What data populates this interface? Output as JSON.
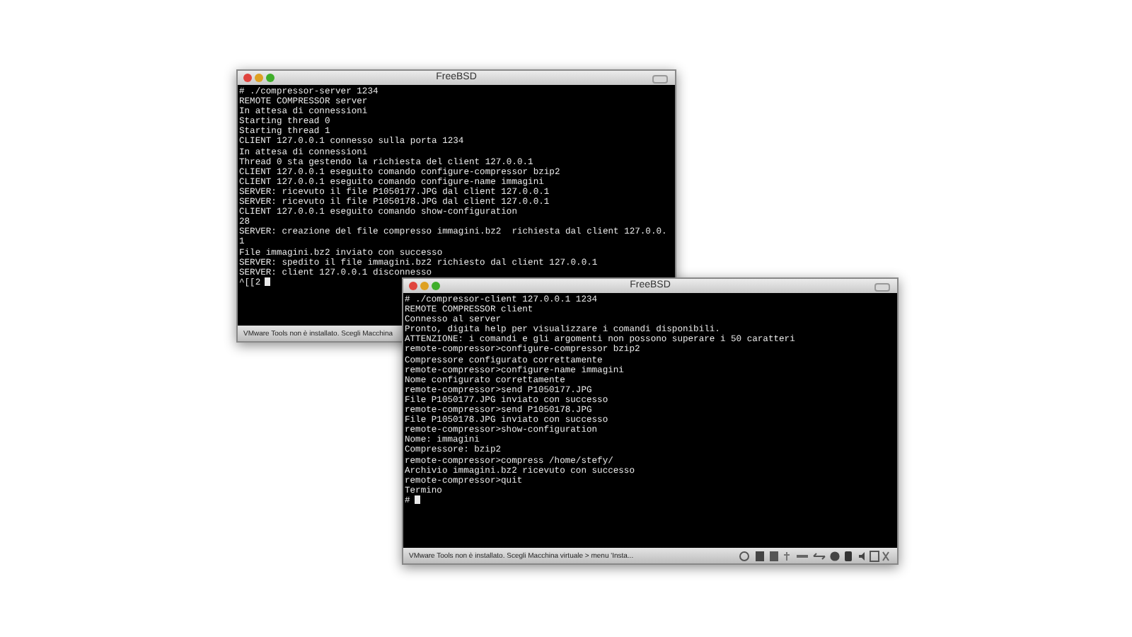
{
  "windows": [
    {
      "title": "FreeBSD",
      "cursor": true,
      "status_text": "VMware Tools non è installato. Scegli Macchina",
      "lines": [
        "# ./compressor-server 1234",
        "REMOTE COMPRESSOR server",
        "In attesa di connessioni",
        "Starting thread 0",
        "Starting thread 1",
        "CLIENT 127.0.0.1 connesso sulla porta 1234",
        "In attesa di connessioni",
        "Thread 0 sta gestendo la richiesta del client 127.0.0.1",
        "CLIENT 127.0.0.1 eseguito comando configure-compressor bzip2",
        "CLIENT 127.0.0.1 eseguito comando configure-name immagini",
        "SERVER: ricevuto il file P1050177.JPG dal client 127.0.0.1",
        "SERVER: ricevuto il file P1050178.JPG dal client 127.0.0.1",
        "CLIENT 127.0.0.1 eseguito comando show-configuration",
        "28",
        "SERVER: creazione del file compresso immagini.bz2  richiesta dal client 127.0.0.",
        "1",
        "File immagini.bz2 inviato con successo",
        "SERVER: spedito il file immagini.bz2 richiesto dal client 127.0.0.1",
        "SERVER: client 127.0.0.1 disconnesso",
        "^[[2"
      ]
    },
    {
      "title": "FreeBSD",
      "cursor": true,
      "status_text": "VMware Tools non è installato. Scegli Macchina virtuale > menu 'Insta...",
      "lines": [
        "# ./compressor-client 127.0.0.1 1234",
        "REMOTE COMPRESSOR client",
        "Connesso al server",
        "Pronto, digita help per visualizzare i comandi disponibili.",
        "ATTENZIONE: i comandi e gli argomenti non possono superare i 50 caratteri",
        "remote-compressor>configure-compressor bzip2",
        "Compressore configurato correttamente",
        "remote-compressor>configure-name immagini",
        "Nome configurato correttamente",
        "remote-compressor>send P1050177.JPG",
        "File P1050177.JPG inviato con successo",
        "remote-compressor>send P1050178.JPG",
        "File P1050178.JPG inviato con successo",
        "remote-compressor>show-configuration",
        "Nome: immagini",
        "Compressore: bzip2",
        "remote-compressor>compress /home/stefy/",
        "Archivio immagini.bz2 ricevuto con successo",
        "remote-compressor>quit",
        "Termino",
        "#"
      ]
    }
  ]
}
